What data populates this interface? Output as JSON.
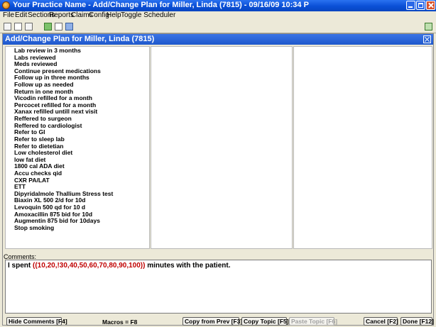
{
  "window": {
    "title": "Your Practice Name - Add/Change Plan for Miller, Linda (7815) - 09/16/09 10:34 P"
  },
  "menu": [
    "File",
    "Edit",
    "Sections",
    "Reports",
    "Claims",
    "Config",
    "Help",
    "Toggle Scheduler"
  ],
  "toolbar": {
    "icons": [
      "new-icon",
      "document-icon",
      "attach-icon",
      "go-icon",
      "preview-icon",
      "print-icon",
      "export-icon"
    ]
  },
  "subwindow": {
    "title": "Add/Change Plan for Miller, Linda (7815)"
  },
  "plan_items": [
    "Lab review in 3 months",
    "Labs reviewed",
    "Meds reviewed",
    "Continue present medications",
    "Follow up in three months",
    "Follow up as needed",
    "Return in one month",
    "Vicodin refilled for a month",
    "Percocet refilled for a month",
    "Xanax refilled untill next visit",
    "Reffered to surgeon",
    "Reffered to cardiologist",
    "Refer to GI",
    "Refer to sleep lab",
    "Refer to dietetian",
    "Low cholesterol diet",
    "low fat diet",
    "1800 cal ADA diet",
    "Accu checks qid",
    "CXR PA/LAT",
    "ETT",
    "Dipyridalmole Thallium Stress test",
    "Biaxin XL 500 2/d for 10d",
    "Levoquin 500 qd for 10 d",
    "Amoxacillin 875 bid for 10d",
    "Augmentin 875 bid for 10days",
    "Stop smoking"
  ],
  "comments": {
    "label": "Comments:",
    "prefix": "I spent  ",
    "macro": "((10,20,!30,40,50,60,70,80,90,100))",
    "suffix": " minutes with the patient."
  },
  "buttons": {
    "hide_comments": "Hide Comments [F4]",
    "macros_info": "Macros = F8",
    "copy_from_prev": "Copy from Prev [F3]",
    "copy_topic": "Copy Topic [F5]",
    "paste_topic": "Paste Topic [F6]",
    "cancel": "Cancel [F2]",
    "done": "Done [F12]"
  },
  "colors": {
    "titlebar": "#0a4fd6",
    "subtitle": "#1e58cc",
    "macro_text": "#c00000",
    "window_bg": "#ece9d8"
  }
}
